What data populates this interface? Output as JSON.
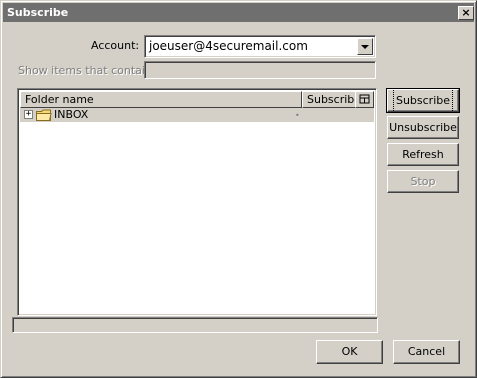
{
  "window": {
    "title": "Subscribe",
    "close_glyph": "×"
  },
  "account": {
    "label": "Account:",
    "value": "joeuser@4securemail.com"
  },
  "filter": {
    "label": "Show items that contain:",
    "value": ""
  },
  "table": {
    "columns": [
      "Folder name",
      "Subscribe"
    ],
    "picker_icon": "column-picker-icon",
    "rows": [
      {
        "expander": "+",
        "icon": "folder-icon",
        "name": "INBOX",
        "subscribe_mark": "•"
      }
    ]
  },
  "side_buttons": {
    "subscribe": "Subscribe",
    "unsubscribe": "Unsubscribe",
    "refresh": "Refresh",
    "stop": "Stop"
  },
  "footer": {
    "status_text": "",
    "ok": "OK",
    "cancel": "Cancel"
  }
}
